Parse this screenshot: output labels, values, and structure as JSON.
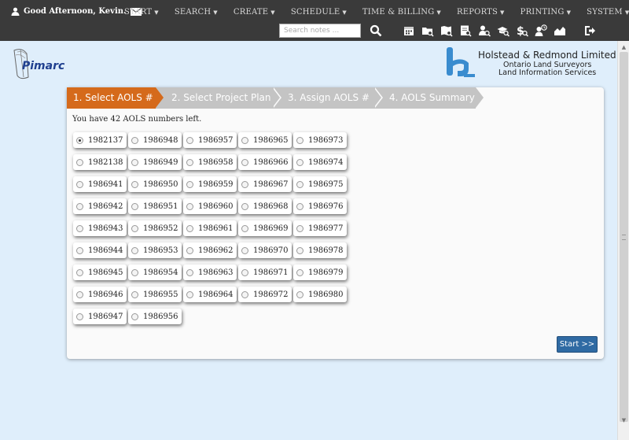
{
  "nav": {
    "greeting": "Good Afternoon, Kevin.",
    "menu": [
      "START",
      "SEARCH",
      "CREATE",
      "SCHEDULE",
      "TIME & BILLING",
      "REPORTS",
      "PRINTING",
      "SYSTEM"
    ],
    "search_placeholder": "Search notes ...",
    "tool_icons": [
      "calendar-icon",
      "folder-search-icon",
      "map-search-icon",
      "document-search-icon",
      "user-search-icon",
      "graduation-search-icon",
      "dollar-search-icon",
      "user-clock-icon",
      "chart-icon",
      "logout-icon"
    ]
  },
  "brand": {
    "app_logo": "Pimarc",
    "company_name": "Holstead & Redmond Limited",
    "company_line1": "Ontario Land Surveyors",
    "company_line2": "Land Information Services"
  },
  "wizard": {
    "steps": [
      "1. Select AOLS #",
      "2. Select Project Plan",
      "3. Assign AOLS #",
      "4. AOLS Summary"
    ],
    "active_step": 0,
    "remaining_text": "You have 42 AOLS numbers left.",
    "selected": "1982137",
    "columns": [
      [
        "1982137",
        "1982138",
        "1986941",
        "1986942",
        "1986943",
        "1986944",
        "1986945",
        "1986946",
        "1986947"
      ],
      [
        "1986948",
        "1986949",
        "1986950",
        "1986951",
        "1986952",
        "1986953",
        "1986954",
        "1986955",
        "1986956"
      ],
      [
        "1986957",
        "1986958",
        "1986959",
        "1986960",
        "1986961",
        "1986962",
        "1986963",
        "1986964"
      ],
      [
        "1986965",
        "1986966",
        "1986967",
        "1986968",
        "1986969",
        "1986970",
        "1986971",
        "1986972"
      ],
      [
        "1986973",
        "1986974",
        "1986975",
        "1986976",
        "1986977",
        "1986978",
        "1986979",
        "1986980"
      ]
    ],
    "start_label": "Start >>"
  }
}
